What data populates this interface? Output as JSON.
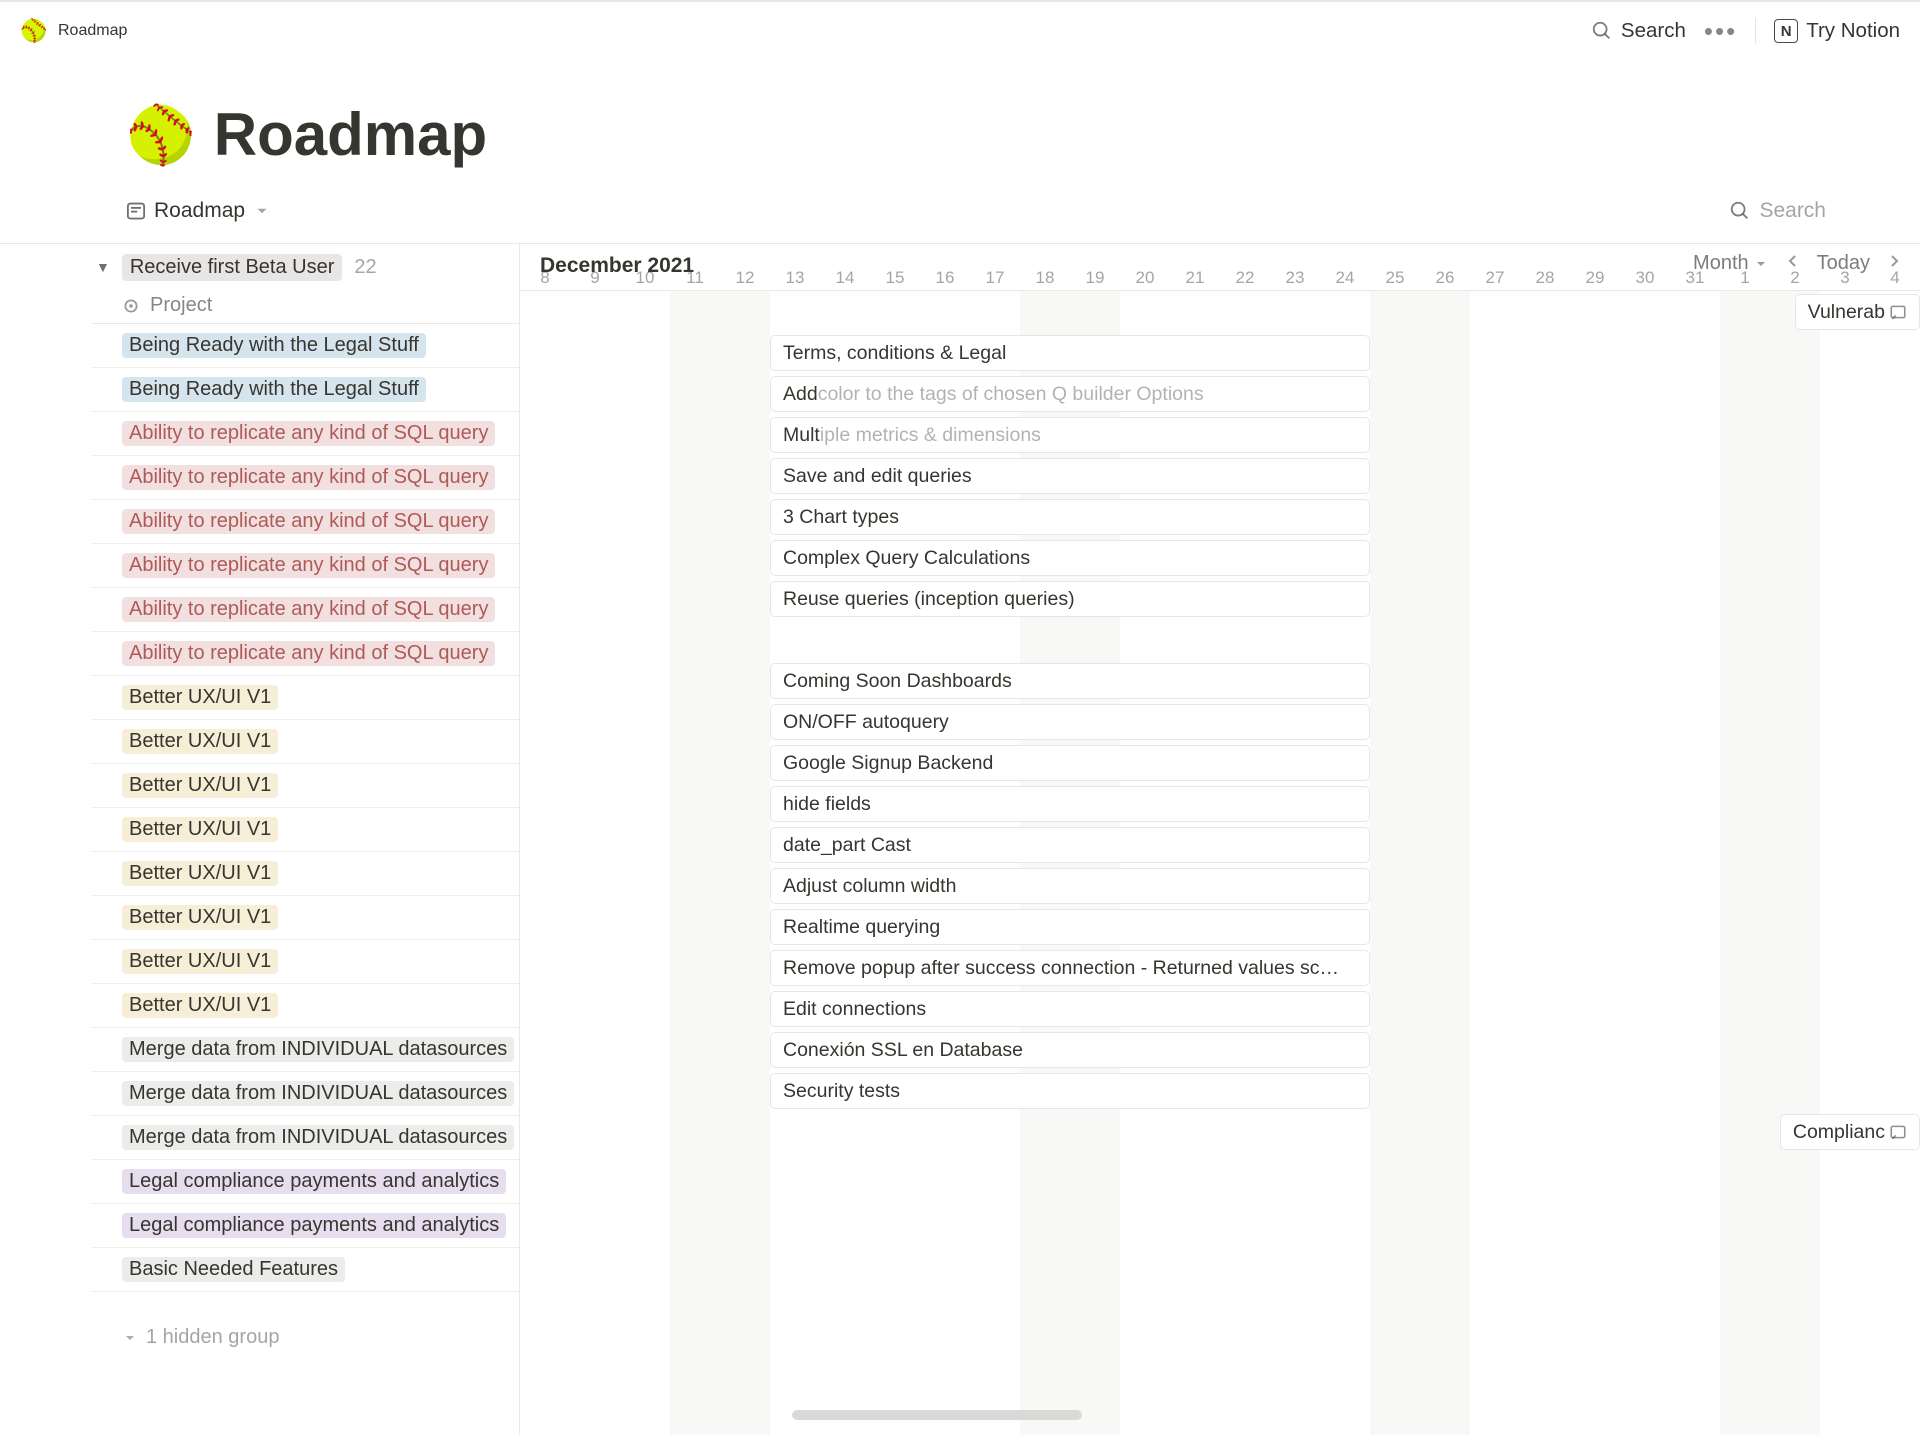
{
  "top": {
    "breadcrumb_title": "Roadmap",
    "search": "Search",
    "try_notion": "Try Notion",
    "logo": "N"
  },
  "page": {
    "emoji": "🥎",
    "title": "Roadmap"
  },
  "view": {
    "name": "Roadmap",
    "search_placeholder": "Search"
  },
  "group": {
    "name": "Receive first Beta User",
    "count": "22",
    "project_label": "Project",
    "hidden_label": "1 hidden group"
  },
  "side_items": [
    {
      "label": "Being Ready with the Legal Stuff",
      "pill": "pill-blue"
    },
    {
      "label": "Being Ready with the Legal Stuff",
      "pill": "pill-blue"
    },
    {
      "label": "Ability to replicate any kind of SQL query",
      "pill": "pill-pink"
    },
    {
      "label": "Ability to replicate any kind of SQL query",
      "pill": "pill-pink"
    },
    {
      "label": "Ability to replicate any kind of SQL query",
      "pill": "pill-pink"
    },
    {
      "label": "Ability to replicate any kind of SQL query",
      "pill": "pill-pink"
    },
    {
      "label": "Ability to replicate any kind of SQL query",
      "pill": "pill-pink"
    },
    {
      "label": "Ability to replicate any kind of SQL query",
      "pill": "pill-pink"
    },
    {
      "label": "Better UX/UI V1",
      "pill": "pill-yellow"
    },
    {
      "label": "Better UX/UI V1",
      "pill": "pill-yellow"
    },
    {
      "label": "Better UX/UI V1",
      "pill": "pill-yellow"
    },
    {
      "label": "Better UX/UI V1",
      "pill": "pill-yellow"
    },
    {
      "label": "Better UX/UI V1",
      "pill": "pill-yellow"
    },
    {
      "label": "Better UX/UI V1",
      "pill": "pill-yellow"
    },
    {
      "label": "Better UX/UI V1",
      "pill": "pill-yellow"
    },
    {
      "label": "Better UX/UI V1",
      "pill": "pill-yellow"
    },
    {
      "label": "Merge data from INDIVIDUAL datasources",
      "pill": "pill-gray"
    },
    {
      "label": "Merge data from INDIVIDUAL datasources",
      "pill": "pill-gray"
    },
    {
      "label": "Merge data from INDIVIDUAL datasources",
      "pill": "pill-gray"
    },
    {
      "label": "Legal compliance payments and analytics",
      "pill": "pill-purple"
    },
    {
      "label": "Legal compliance payments and analytics",
      "pill": "pill-purple"
    },
    {
      "label": "Basic Needed Features",
      "pill": "pill-gray"
    }
  ],
  "timeline": {
    "month_label": "December 2021",
    "controls": {
      "range": "Month",
      "today": "Today"
    },
    "days": [
      "8",
      "9",
      "10",
      "11",
      "12",
      "13",
      "14",
      "15",
      "16",
      "17",
      "18",
      "19",
      "20",
      "21",
      "22",
      "23",
      "24",
      "25",
      "26",
      "27",
      "28",
      "29",
      "30",
      "31",
      "1",
      "2",
      "3",
      "4"
    ],
    "col_count": 28,
    "weekend_cols": [
      [
        3,
        2
      ],
      [
        10,
        2
      ],
      [
        17,
        2
      ],
      [
        24,
        2
      ]
    ]
  },
  "tasks": [
    {
      "row": 0,
      "blank": true
    },
    {
      "row": 1,
      "full": "Terms, conditions & Legal",
      "fade": ""
    },
    {
      "row": 2,
      "full": "Add ",
      "fade": "color to the tags of chosen Q builder Options"
    },
    {
      "row": 3,
      "full": "Mult",
      "fade": "iple metrics & dimensions"
    },
    {
      "row": 4,
      "full": "Save and edit queries",
      "fade": ""
    },
    {
      "row": 5,
      "full": "3 Chart types",
      "fade": ""
    },
    {
      "row": 6,
      "full": "Complex Query Calculations",
      "fade": ""
    },
    {
      "row": 7,
      "full": "Reuse queries (inception queries)",
      "fade": ""
    },
    {
      "row": 8,
      "blank": true
    },
    {
      "row": 9,
      "full": "Coming Soon Dashboards",
      "fade": ""
    },
    {
      "row": 10,
      "full": "ON/OFF autoquery",
      "fade": ""
    },
    {
      "row": 11,
      "full": "Google Signup Backend",
      "fade": ""
    },
    {
      "row": 12,
      "full": "hide fields",
      "fade": ""
    },
    {
      "row": 13,
      "full": "date_part Cast",
      "fade": ""
    },
    {
      "row": 14,
      "full": "Adjust column width",
      "fade": ""
    },
    {
      "row": 15,
      "full": "Realtime querying",
      "fade": ""
    },
    {
      "row": 16,
      "full": "Remove popup after success connection - Returned values sc…",
      "fade": ""
    },
    {
      "row": 17,
      "full": "Edit connections",
      "fade": ""
    },
    {
      "row": 18,
      "full": "Conexión SSL en Database",
      "fade": ""
    },
    {
      "row": 19,
      "full": "Security tests",
      "fade": ""
    }
  ],
  "truncated_right": [
    {
      "row": 0,
      "label": "Vulnerab"
    },
    {
      "row": 20,
      "label": "Complianc"
    }
  ]
}
